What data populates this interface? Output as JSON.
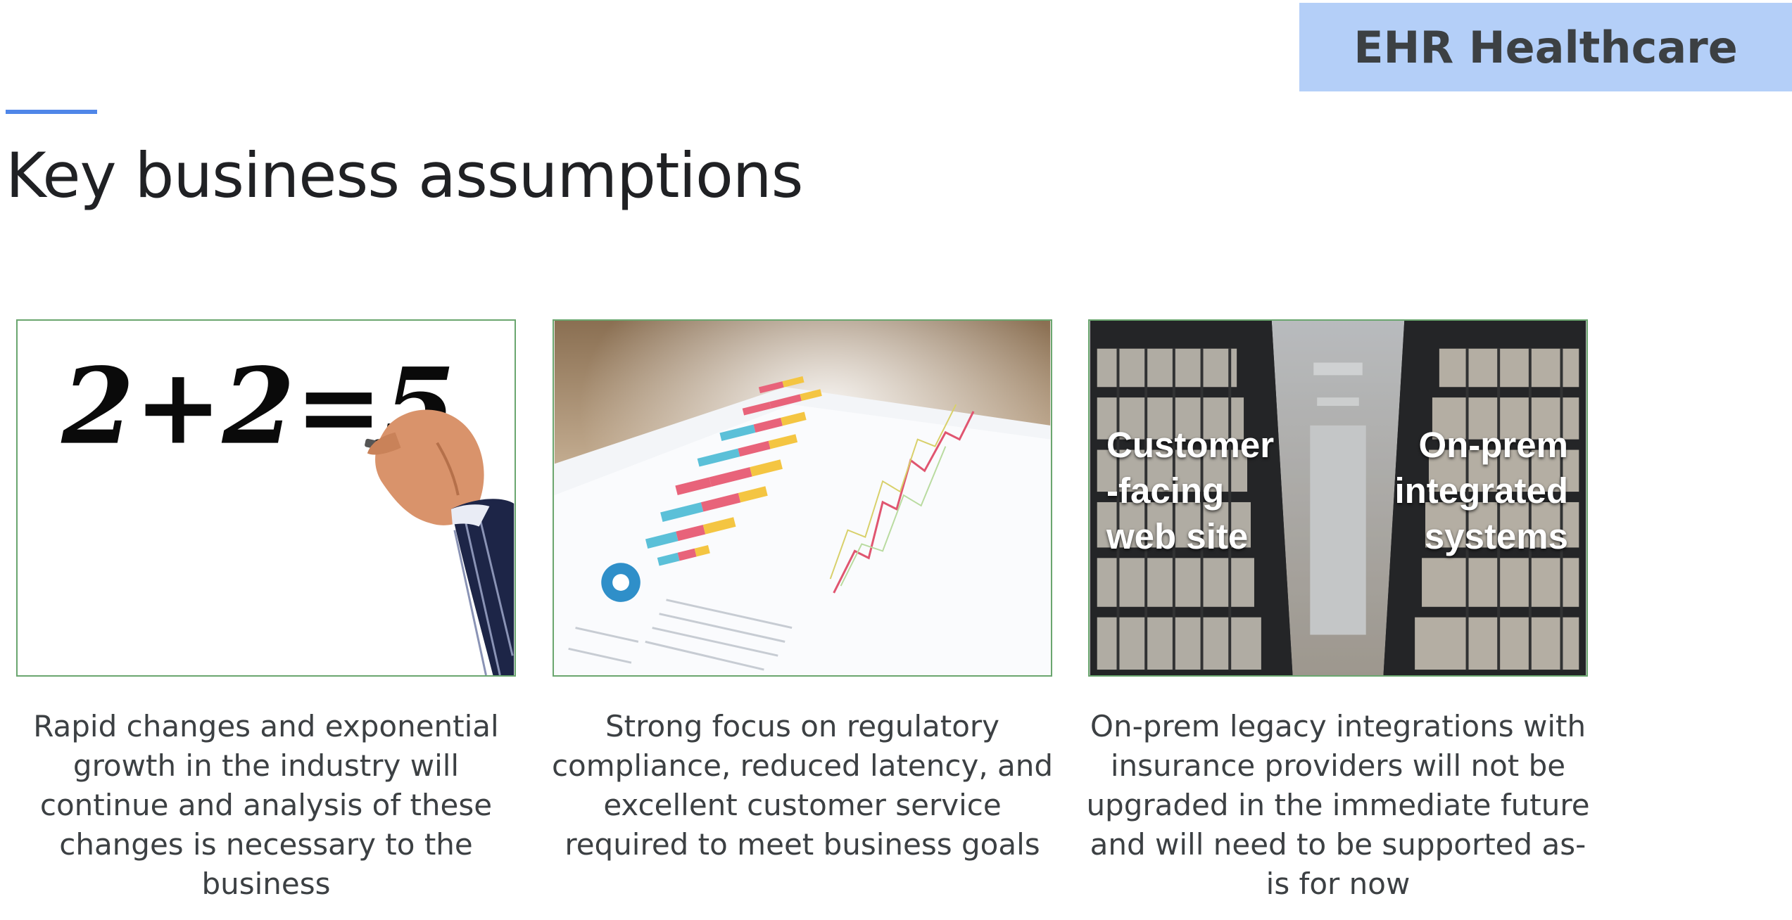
{
  "header": {
    "badge": "EHR Healthcare",
    "title": "Key business assumptions"
  },
  "cards": [
    {
      "math": "2+2=5",
      "caption": "Rapid changes and exponential growth in the industry will continue and analysis of these changes is necessary to the business"
    },
    {
      "caption": "Strong focus on regulatory compliance, reduced latency, and excellent customer service required to meet business goals"
    },
    {
      "label_left": "Customer\n-facing\nweb site",
      "label_right": "On-prem\nintegrated\nsystems",
      "caption": "On-prem legacy integrations with insurance providers will not be upgraded in the immediate future and will need to be supported as-is for now"
    }
  ]
}
